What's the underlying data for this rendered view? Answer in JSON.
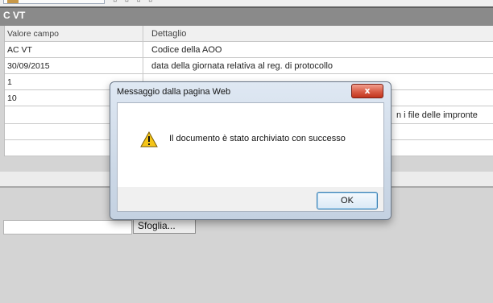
{
  "toolbar": {
    "cut_button_label": ""
  },
  "header": {
    "title": "C VT"
  },
  "table": {
    "columns": [
      "Valore campo",
      "Dettaglio"
    ],
    "rows": [
      {
        "value": "AC VT",
        "detail": "Codice della AOO"
      },
      {
        "value": "30/09/2015",
        "detail": "data della giornata relativa al reg. di protocollo"
      },
      {
        "value": "1",
        "detail": ""
      },
      {
        "value": "10",
        "detail": ""
      },
      {
        "value": "",
        "detail": "n i file delle impronte"
      },
      {
        "value": "",
        "detail": ""
      },
      {
        "value": "",
        "detail": ""
      }
    ]
  },
  "upload": {
    "browse_label": "Sfoglia..."
  },
  "dialog": {
    "title": "Messaggio dalla pagina Web",
    "close_label": "x",
    "icon": "warning-icon",
    "message": "Il documento è stato archiviato con successo",
    "ok_label": "OK"
  },
  "colors": {
    "header_bg": "#8a8a8a",
    "close_red": "#c1341c",
    "ok_border": "#3c7fb1"
  }
}
